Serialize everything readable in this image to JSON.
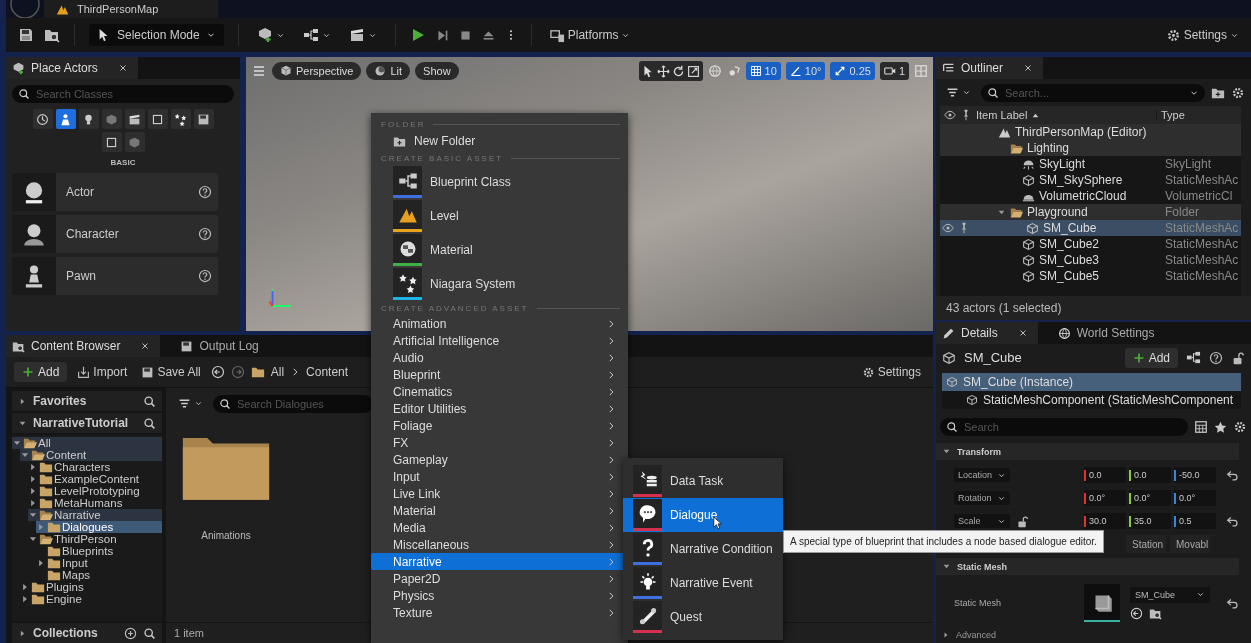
{
  "title_bar": {
    "tab": "ThirdPersonMap"
  },
  "toolbar": {
    "mode": "Selection Mode",
    "platforms": "Platforms",
    "settings": "Settings"
  },
  "place_actors": {
    "tab": "Place Actors",
    "search_placeholder": "Search Classes",
    "categories": [
      {
        "selected": false
      },
      {
        "selected": true
      },
      {
        "selected": false
      },
      {
        "selected": false
      },
      {
        "selected": false
      },
      {
        "selected": false
      },
      {
        "selected": false
      },
      {
        "selected": false
      },
      {
        "selected": false
      },
      {
        "selected": false
      }
    ],
    "section": "BASIC",
    "items": [
      {
        "label": "Actor"
      },
      {
        "label": "Character"
      },
      {
        "label": "Pawn"
      }
    ]
  },
  "viewport": {
    "view": "Perspective",
    "lighting": "Lit",
    "show": "Show",
    "grid_snap": "10",
    "rotation_snap": "10°",
    "scale_snap": "0.25",
    "camera_speed": "1"
  },
  "content_browser": {
    "tabs": [
      {
        "label": "Content Browser",
        "selected": true
      },
      {
        "label": "Output Log",
        "selected": false
      }
    ],
    "add": "Add",
    "import": "Import",
    "save_all": "Save All",
    "path": [
      "All",
      "Content"
    ],
    "settings": "Settings",
    "favorites": "Favorites",
    "project": "NarrativeTutorial",
    "tree": [
      {
        "label": "All",
        "expandable": true,
        "expanded": true,
        "selected": false,
        "highlighted": true,
        "children": [
          {
            "label": "Content",
            "expandable": true,
            "expanded": true,
            "selected": false,
            "highlighted": true,
            "children": [
              {
                "label": "Characters",
                "expandable": true,
                "expanded": false,
                "selected": false,
                "highlighted": false
              },
              {
                "label": "ExampleContent",
                "expandable": true,
                "expanded": false,
                "selected": false,
                "highlighted": false
              },
              {
                "label": "LevelPrototyping",
                "expandable": true,
                "expanded": false,
                "selected": false,
                "highlighted": false
              },
              {
                "label": "MetaHumans",
                "expandable": true,
                "expanded": false,
                "selected": false,
                "highlighted": false
              },
              {
                "label": "Narrative",
                "expandable": true,
                "expanded": true,
                "selected": false,
                "highlighted": true,
                "children": [
                  {
                    "label": "Dialogues",
                    "expandable": true,
                    "expanded": false,
                    "selected": true,
                    "highlighted": false
                  }
                ]
              },
              {
                "label": "ThirdPerson",
                "expandable": true,
                "expanded": true,
                "selected": false,
                "highlighted": false,
                "children": [
                  {
                    "label": "Blueprints",
                    "expandable": false,
                    "expanded": false,
                    "selected": false,
                    "highlighted": false
                  },
                  {
                    "label": "Input",
                    "expandable": true,
                    "expanded": false,
                    "selected": false,
                    "highlighted": false
                  },
                  {
                    "label": "Maps",
                    "expandable": false,
                    "expanded": false,
                    "selected": false,
                    "highlighted": false
                  }
                ]
              }
            ]
          },
          {
            "label": "Plugins",
            "expandable": true,
            "expanded": false,
            "selected": false,
            "highlighted": false
          },
          {
            "label": "Engine",
            "expandable": true,
            "expanded": false,
            "selected": false,
            "highlighted": false
          }
        ]
      }
    ],
    "collections": "Collections",
    "search_placeholder": "Search Dialogues",
    "assets": [
      {
        "label": "Animations"
      }
    ],
    "status": "1 item"
  },
  "outliner": {
    "tab": "Outliner",
    "search_placeholder": "Search...",
    "columns": [
      "Item Label",
      "Type"
    ],
    "rows": [
      {
        "label": "ThirdPersonMap (Editor)",
        "kind": "level",
        "expanded": false,
        "selected": false,
        "highlighted": true,
        "children": [
          {
            "label": "Lighting",
            "kind": "folder",
            "expanded": false,
            "selected": false,
            "highlighted": true,
            "children": [
              {
                "label": "SkyLight",
                "type": "SkyLight",
                "kind": "light",
                "expanded": false,
                "selected": false,
                "highlighted": false
              },
              {
                "label": "SM_SkySphere",
                "type": "StaticMeshAc",
                "kind": "mesh",
                "expanded": false,
                "selected": false,
                "highlighted": false
              },
              {
                "label": "VolumetricCloud",
                "type": "VolumetricCl",
                "kind": "cloud",
                "expanded": false,
                "selected": false,
                "highlighted": false
              }
            ]
          },
          {
            "label": "Playground",
            "type": "Folder",
            "kind": "folder",
            "expanded": true,
            "selected": false,
            "highlighted": true,
            "children": [
              {
                "label": "SM_Cube",
                "type": "StaticMeshAc",
                "kind": "mesh",
                "expanded": false,
                "selected": true,
                "highlighted": false
              },
              {
                "label": "SM_Cube2",
                "type": "StaticMeshAc",
                "kind": "mesh",
                "expanded": false,
                "selected": false,
                "highlighted": false
              },
              {
                "label": "SM_Cube3",
                "type": "StaticMeshAc",
                "kind": "mesh",
                "expanded": false,
                "selected": false,
                "highlighted": false
              },
              {
                "label": "SM_Cube5",
                "type": "StaticMeshAc",
                "kind": "mesh",
                "expanded": false,
                "selected": false,
                "highlighted": false
              }
            ]
          }
        ]
      }
    ],
    "status": "43 actors (1 selected)"
  },
  "details": {
    "tabs": [
      {
        "label": "Details",
        "selected": true
      },
      {
        "label": "World Settings",
        "selected": false
      }
    ],
    "actor": "SM_Cube",
    "add": "Add",
    "components": [
      {
        "label": "SM_Cube (Instance)",
        "selected": true,
        "children": [
          {
            "label": "StaticMeshComponent (StaticMeshComponent",
            "selected": false
          }
        ]
      }
    ],
    "search_placeholder": "Search",
    "transform": {
      "title": "Transform",
      "rows": [
        {
          "label": "Location",
          "values": [
            "0.0",
            "0.0",
            "-50.0"
          ],
          "lock": false,
          "reset": true
        },
        {
          "label": "Rotation",
          "values": [
            "0.0°",
            "0.0°",
            "0.0°"
          ],
          "lock": false,
          "reset": false
        },
        {
          "label": "Scale",
          "values": [
            "30.0",
            "35.0",
            "0.5"
          ],
          "lock": true,
          "reset": true
        }
      ],
      "mobility": [
        "Station",
        "Movabl"
      ]
    },
    "static_mesh": {
      "title": "Static Mesh",
      "label": "Static Mesh",
      "value": "SM_Cube"
    },
    "advanced": "Advanced"
  },
  "context_menu": {
    "sections": [
      {
        "header": "FOLDER",
        "items": [
          {
            "label": "New Folder",
            "kind": "folder",
            "selected": false
          }
        ]
      },
      {
        "header": "CREATE BASIC ASSET",
        "items": [
          {
            "label": "Blueprint Class",
            "kind": "asset",
            "color": "#3d6fe0",
            "selected": false
          },
          {
            "label": "Level",
            "kind": "asset",
            "color": "#e8a21c",
            "selected": false
          },
          {
            "label": "Material",
            "kind": "asset",
            "color": "#3fb043",
            "selected": false
          },
          {
            "label": "Niagara System",
            "kind": "asset",
            "color": "#1fb2e6",
            "selected": false
          }
        ]
      },
      {
        "header": "CREATE ADVANCED ASSET",
        "items": [
          {
            "label": "Animation",
            "kind": "category",
            "selected": false
          },
          {
            "label": "Artificial Intelligence",
            "kind": "category",
            "selected": false
          },
          {
            "label": "Audio",
            "kind": "category",
            "selected": false
          },
          {
            "label": "Blueprint",
            "kind": "category",
            "selected": false
          },
          {
            "label": "Cinematics",
            "kind": "category",
            "selected": false
          },
          {
            "label": "Editor Utilities",
            "kind": "category",
            "selected": false
          },
          {
            "label": "Foliage",
            "kind": "category",
            "selected": false
          },
          {
            "label": "FX",
            "kind": "category",
            "selected": false
          },
          {
            "label": "Gameplay",
            "kind": "category",
            "selected": false
          },
          {
            "label": "Input",
            "kind": "category",
            "selected": false
          },
          {
            "label": "Live Link",
            "kind": "category",
            "selected": false
          },
          {
            "label": "Material",
            "kind": "category",
            "selected": false
          },
          {
            "label": "Media",
            "kind": "category",
            "selected": false
          },
          {
            "label": "Miscellaneous",
            "kind": "category",
            "selected": false
          },
          {
            "label": "Narrative",
            "kind": "category",
            "selected": true
          },
          {
            "label": "Paper2D",
            "kind": "category",
            "selected": false
          },
          {
            "label": "Physics",
            "kind": "category",
            "selected": false
          },
          {
            "label": "Texture",
            "kind": "category",
            "selected": false
          }
        ]
      }
    ]
  },
  "submenu": {
    "items": [
      {
        "label": "Data Task",
        "color": "#d6304f",
        "selected": false
      },
      {
        "label": "Dialogue",
        "color": "#d6304f",
        "selected": true
      },
      {
        "label": "Narrative Condition",
        "color": "#3d6fe0",
        "selected": false
      },
      {
        "label": "Narrative Event",
        "color": "#3d6fe0",
        "selected": false
      },
      {
        "label": "Quest",
        "color": "#d6304f",
        "selected": false
      }
    ]
  },
  "tooltip": "A special type of blueprint that includes a node based dialogue editor."
}
